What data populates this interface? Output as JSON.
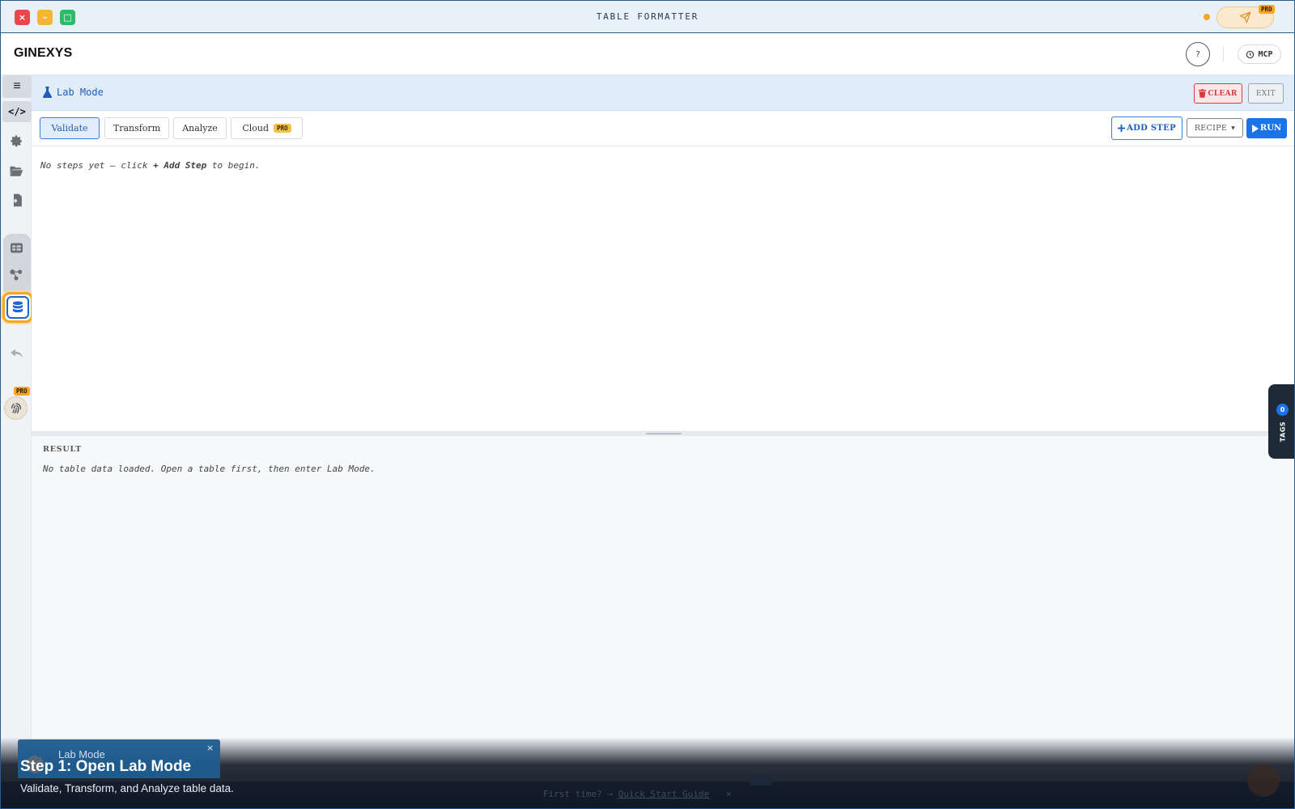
{
  "window": {
    "title": "TABLE FORMATTER",
    "close_glyph": "×",
    "min_glyph": "–",
    "max_glyph": "□",
    "send_icon": "paper-plane-icon",
    "pro_badge": "PRO"
  },
  "header": {
    "brand": "GINEXYS",
    "help_label": "?",
    "mcp_label": "MCP"
  },
  "sidebar": {
    "menu_glyph": "≡",
    "code_label": "</>",
    "icons": [
      "gear-icon",
      "folder-open-icon",
      "file-import-icon",
      "table-icon",
      "flow-icon",
      "database-icon",
      "undo-icon",
      "fingerprint-icon"
    ],
    "pro_badge": "PRO"
  },
  "lab": {
    "title": "Lab Mode",
    "clear_label": "CLEAR",
    "exit_label": "EXIT"
  },
  "toolbar": {
    "tabs": [
      {
        "label": "Validate",
        "active": true
      },
      {
        "label": "Transform",
        "active": false
      },
      {
        "label": "Analyze",
        "active": false
      },
      {
        "label": "Cloud",
        "active": false,
        "badge": "PRO"
      }
    ],
    "add_step_label": "ADD STEP",
    "recipe_label": "RECIPE",
    "recipe_caret": "▾",
    "run_label": "RUN"
  },
  "steps": {
    "empty_prefix": "No steps yet — click ",
    "empty_action": "+ Add Step",
    "empty_suffix": " to begin."
  },
  "result": {
    "label": "RESULT",
    "message": "No table data loaded. Open a table first, then enter Lab Mode."
  },
  "tags": {
    "count": "0",
    "label": "TAGS"
  },
  "tour": {
    "card_title": "Lab Mode",
    "card_close": "×",
    "step_title": "Step 1: Open Lab Mode",
    "step_desc": "Validate, Transform, and Analyze table data."
  },
  "footer": {
    "prefix": "First time? →",
    "link": "Quick Start Guide",
    "close": "×"
  },
  "colors": {
    "accent": "#1a73e8",
    "highlight": "#f5a623",
    "danger": "#d9393f",
    "pro": "#f5c04a"
  }
}
